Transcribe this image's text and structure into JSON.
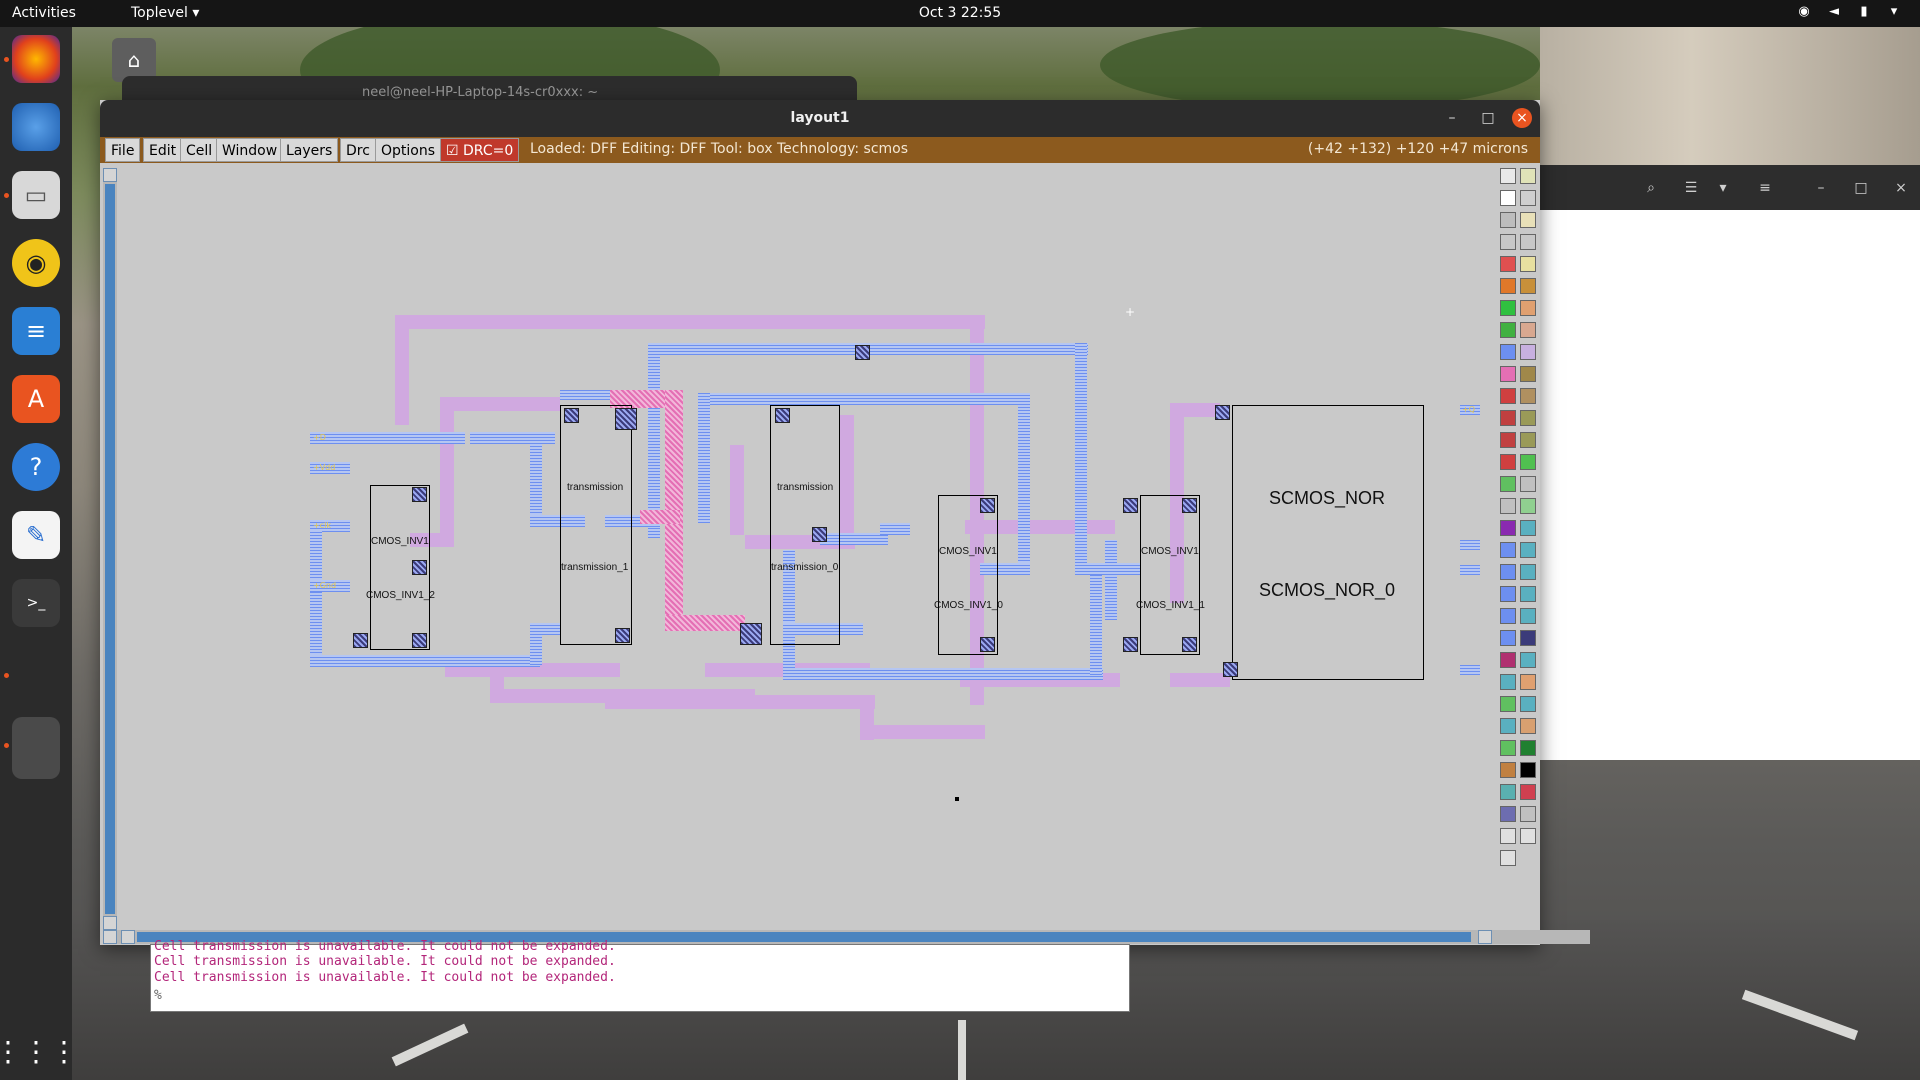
{
  "topbar": {
    "activities": "Activities",
    "app_menu": "Toplevel ▾",
    "clock": "Oct 3  22:55"
  },
  "dock": {
    "items": [
      "firefox-icon",
      "thunderbird-icon",
      "files-icon",
      "rhythmbox-icon",
      "writer-icon",
      "software-icon",
      "help-icon",
      "text-editor-icon",
      "terminal-icon",
      "blank-app-icon",
      "show-apps-icon"
    ]
  },
  "background_terminal": {
    "title": "neel@neel-HP-Laptop-14s-cr0xxx: ~"
  },
  "window": {
    "title": "layout1",
    "menu": [
      "File",
      "Edit",
      "Cell",
      "Window",
      "Layers",
      "Drc",
      "Options"
    ],
    "drc_label": "DRC=0",
    "status": "Loaded: DFF Editing: DFF Tool: box  Technology: scmos",
    "coords": "(+42 +132) +120 +47 microns"
  },
  "layout": {
    "cells": {
      "inv2": [
        "CMOS_INV1",
        "CMOS_INV1_2"
      ],
      "t1": [
        "transmission",
        "transmission_1"
      ],
      "t0": [
        "transmission",
        "transmission_0"
      ],
      "inv0": [
        "CMOS_INV1",
        "CMOS_INV1_0"
      ],
      "inv1": [
        "CMOS_INV1",
        "CMOS_INV1_1"
      ],
      "nor": [
        "SCMOS_NOR",
        "SCMOS_NOR_0"
      ]
    }
  },
  "console": {
    "lines": [
      "Cell transmission is unavailable.  It could not be expanded.",
      "Cell transmission is unavailable.  It could not be expanded.",
      "Cell transmission is unavailable.  It could not be expanded.",
      "%"
    ]
  },
  "colors": {
    "menubar": "#8c5a1e",
    "poly": "#d0a9e0",
    "metal": "#6d8ff0",
    "pdiff": "#e46fb4",
    "accent": "#e95420"
  }
}
